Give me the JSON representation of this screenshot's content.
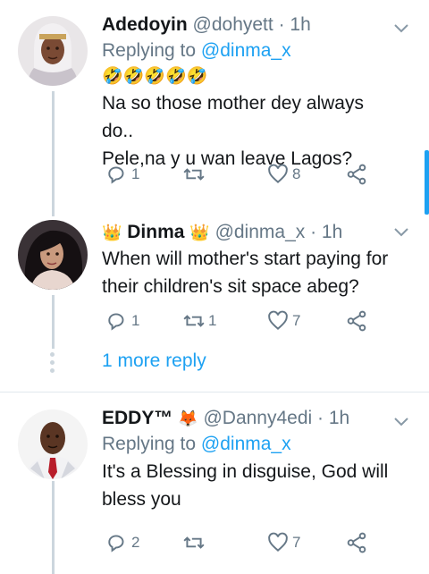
{
  "tweets": [
    {
      "name": "Adedoyin",
      "handle": "@dohyett",
      "time": "· 1h",
      "reply_prefix": "Replying to",
      "reply_handle": "@dinma_x",
      "emoji_line": "🤣🤣🤣🤣🤣",
      "text_lines": [
        "Na so those mother dey always do..",
        "Pele,na y u wan leave Lagos?"
      ],
      "replies": "1",
      "retweets": "",
      "likes": "8"
    },
    {
      "name": "Dinma",
      "badge": "👑",
      "handle": "@dinma_x",
      "time": "· 1h",
      "text_lines": [
        "When will mother's start paying for",
        "their children's sit space abeg?"
      ],
      "replies": "1",
      "retweets": "1",
      "likes": "7"
    },
    {
      "name": "EDDY™",
      "badge": "🦊",
      "handle": "@Danny4edi",
      "time": "· 1h",
      "reply_prefix": "Replying to",
      "reply_handle": "@dinma_x",
      "text_lines": [
        "It's a Blessing in disguise, God will",
        "bless you"
      ],
      "replies": "2",
      "retweets": "",
      "likes": "7"
    }
  ],
  "more_reply": "1 more reply",
  "colors": {
    "accent": "#1da1f2",
    "muted": "#657786",
    "divider": "#e1e8ed"
  }
}
